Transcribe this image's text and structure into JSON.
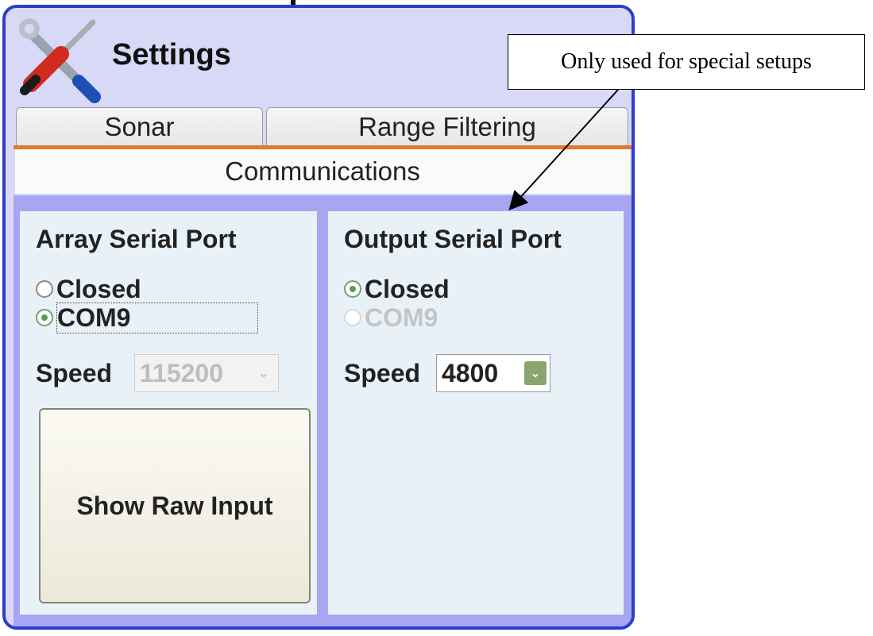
{
  "window": {
    "title": "Settings",
    "icon": "wrench-screwdriver-icon"
  },
  "tabs": {
    "row1": [
      "Sonar",
      "Range Filtering"
    ],
    "active": "Communications"
  },
  "left_panel": {
    "title": "Array Serial Port",
    "options": [
      {
        "label": "Closed",
        "checked": false,
        "enabled": true
      },
      {
        "label": "COM9",
        "checked": true,
        "enabled": true
      }
    ],
    "speed_label": "Speed",
    "speed_value": "115200",
    "speed_enabled": false,
    "button_label": "Show Raw Input"
  },
  "right_panel": {
    "title": "Output Serial Port",
    "options": [
      {
        "label": "Closed",
        "checked": true,
        "enabled": true
      },
      {
        "label": "COM9",
        "checked": false,
        "enabled": false
      }
    ],
    "speed_label": "Speed",
    "speed_value": "4800",
    "speed_enabled": true
  },
  "callout": {
    "text": "Only used for special setups"
  },
  "colors": {
    "window_border": "#2b3ec9",
    "accent": "#e07a33",
    "panel_bg": "#e9f1f8",
    "frame_bg": "#a6a6f3"
  }
}
